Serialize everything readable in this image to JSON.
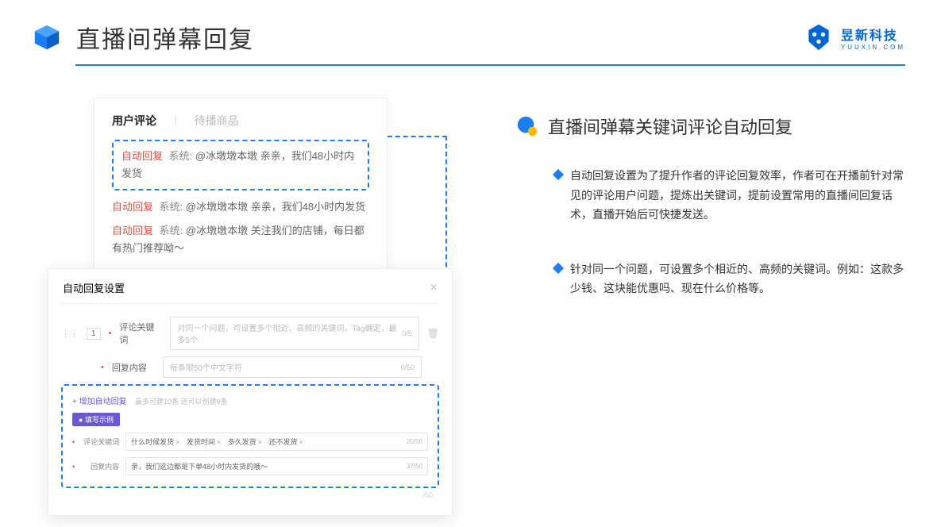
{
  "header": {
    "title": "直播间弹幕回复",
    "brand_name": "昱新科技",
    "brand_sub": "YUUXIN.COM"
  },
  "card1": {
    "tab1": "用户评论",
    "tab2": "待播商品",
    "auto_label": "自动回复",
    "sys_label": "系统:",
    "c1": "@冰墩墩本墩 亲亲，我们48小时内发货",
    "c2": "@冰墩墩本墩 亲亲，我们48小时内发货",
    "c3": "@冰墩墩本墩 关注我们的店铺，每日都有热门推荐呦～"
  },
  "card2": {
    "title": "自动回复设置",
    "num": "1",
    "kw_label": "评论关键词",
    "kw_placeholder": "对同一个问题，可设置多个相近、高频的关键词，Tag确定，最多5个",
    "kw_count": "0/5",
    "rc_label": "回复内容",
    "rc_placeholder": "每条限50个中文字符",
    "rc_count": "0/50",
    "add_link": "+ 增加自动回复",
    "add_note": "最多可建10条 还可以创建9条",
    "ex_badge": "● 填写示例",
    "ex_kw_label": "评论关键词",
    "ex_tags": [
      "什么时候发货",
      "发货时间",
      "多久发货",
      "还不发货"
    ],
    "ex_kw_count": "20/50",
    "ex_rc_label": "回复内容",
    "ex_rc_value": "亲，我们这边都是下单48小时内发货的哦～",
    "ex_rc_count": "37/50",
    "outer_count": "/50"
  },
  "right": {
    "sub_title": "直播间弹幕关键词评论自动回复",
    "b1": "自动回复设置为了提升作者的评论回复效率，作者可在开播前针对常见的评论用户问题，提炼出关键词，提前设置常用的直播间回复话术，直播开始后可快捷发送。",
    "b2": "针对同一个问题，可设置多个相近的、高频的关键词。例如：这款多少钱、这块能优惠吗、现在什么价格等。"
  }
}
